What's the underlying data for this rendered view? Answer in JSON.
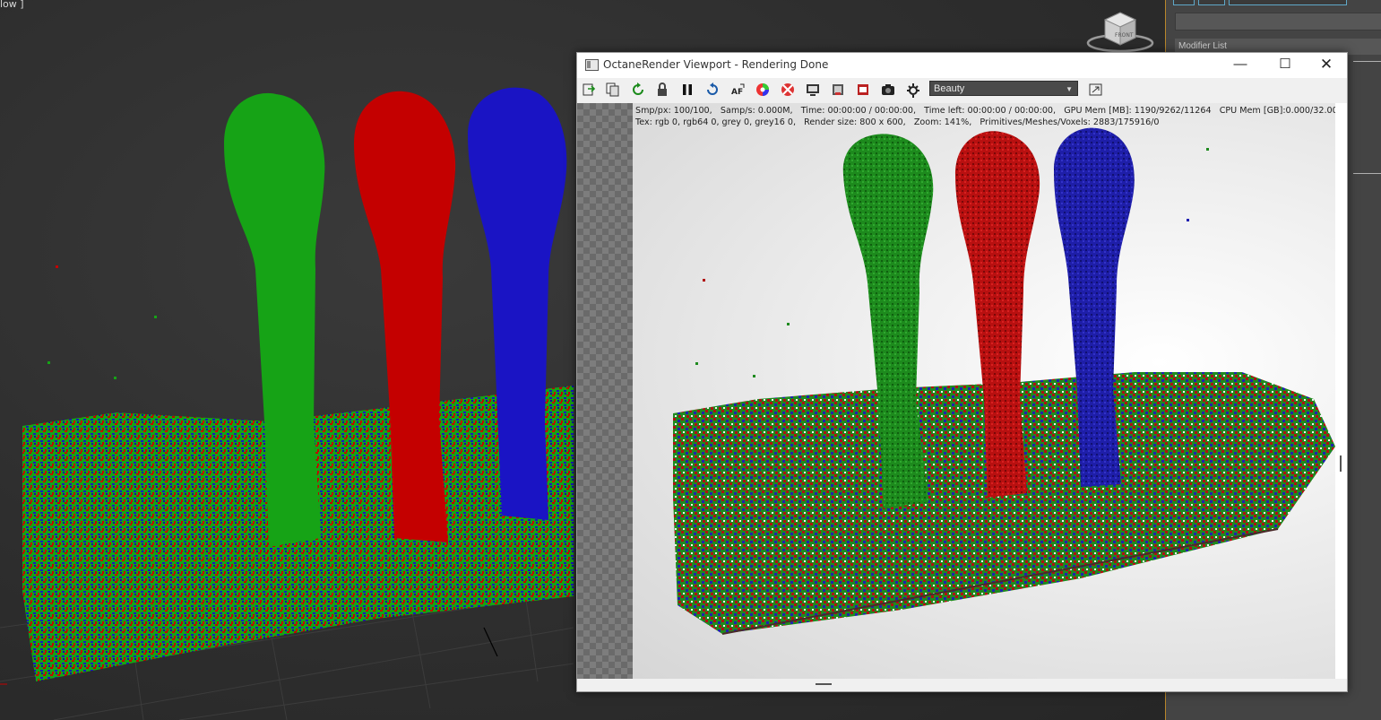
{
  "viewport": {
    "label": "low ]"
  },
  "viewcube": {
    "face_label": "FRONT"
  },
  "command_panel": {
    "modifier_list_label": "Modifier List"
  },
  "octane": {
    "title": "OctaneRender Viewport - Rendering Done",
    "window_buttons": {
      "minimize": "—",
      "maximize": "☐",
      "close": "✕"
    },
    "toolbar": {
      "icons": [
        "export-icon",
        "copy-icon",
        "refresh-icon",
        "lock-icon",
        "pause-icon",
        "restart-icon",
        "af-focus-icon",
        "color-wheel-icon",
        "region-icon",
        "monitor-icon",
        "film-icon",
        "film-red-icon",
        "camera-icon",
        "settings-icon"
      ],
      "view_mode": "Beauty"
    },
    "stats_line1": "Smp/px: 100/100,   Samp/s: 0.000M,   Time: 00:00:00 / 00:00:00,   Time left: 00:00:00 / 00:00:00,   GPU Mem [MB]: 1190/9262/11264   CPU Mem [GB]:0.000/32.00",
    "stats_line2": "Tex: rgb 0, rgb64 0, grey 0, grey16 0,   Render size: 800 x 600,   Zoom: 141%,   Primitives/Meshes/Voxels: 2883/175916/0"
  },
  "colors": {
    "green_fluid": "#18a018",
    "red_fluid": "#c40000",
    "blue_fluid": "#1a14c4",
    "panel_accent": "#b8862a"
  }
}
